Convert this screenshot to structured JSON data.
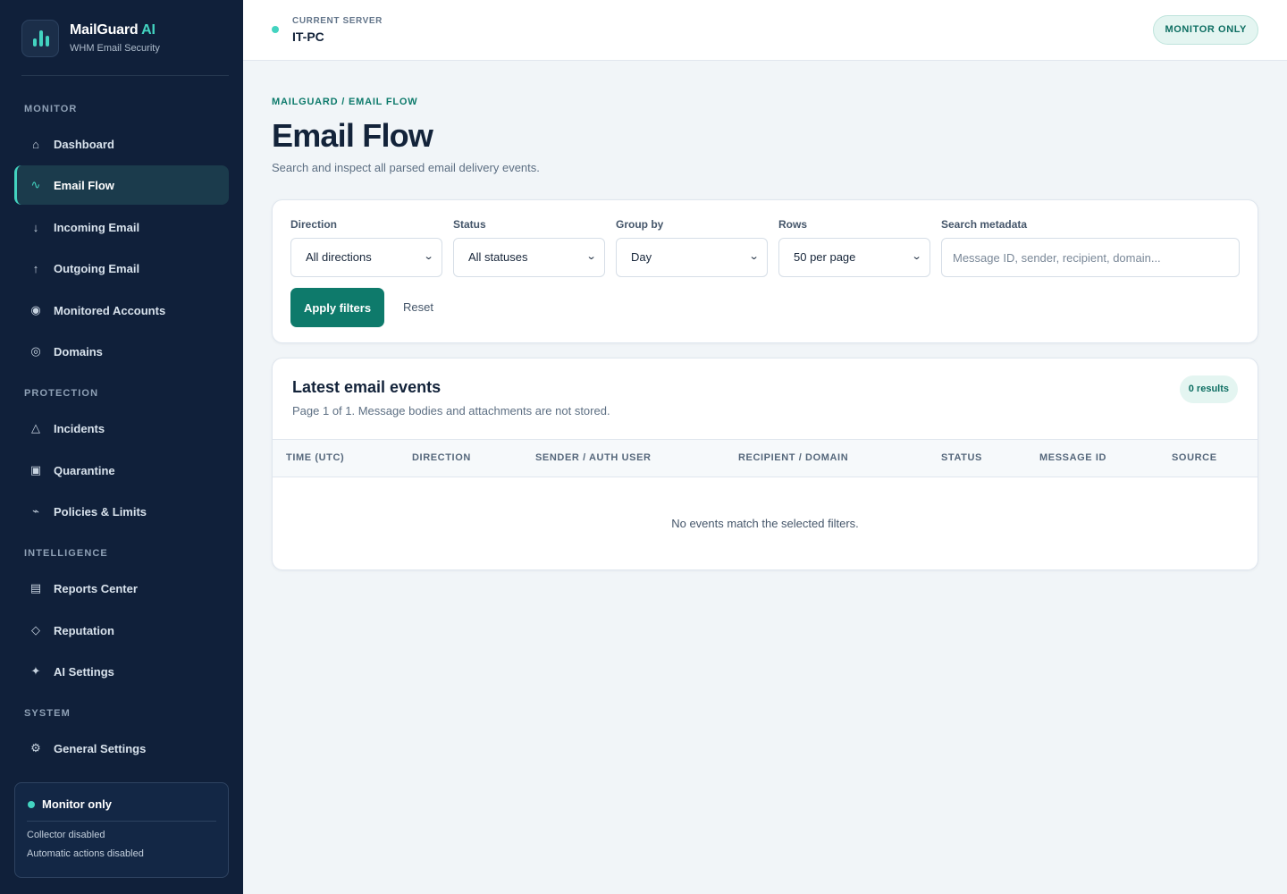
{
  "brand": {
    "name": "MailGuard",
    "name_accent": "AI",
    "subtitle": "WHM Email Security"
  },
  "sidebar": {
    "sections": {
      "monitor": "MONITOR",
      "protection": "PROTECTION",
      "intelligence": "INTELLIGENCE",
      "system": "SYSTEM"
    },
    "items": {
      "dashboard": {
        "label": "Dashboard",
        "icon": "home-icon",
        "glyph": "⌂"
      },
      "email_flow": {
        "label": "Email Flow",
        "icon": "flow-icon",
        "glyph": "∿"
      },
      "incoming": {
        "label": "Incoming Email",
        "icon": "arrow-down-icon",
        "glyph": "↓"
      },
      "outgoing": {
        "label": "Outgoing Email",
        "icon": "arrow-up-icon",
        "glyph": "↑"
      },
      "accounts": {
        "label": "Monitored Accounts",
        "icon": "accounts-icon",
        "glyph": "◉"
      },
      "domains": {
        "label": "Domains",
        "icon": "domains-icon",
        "glyph": "◎"
      },
      "incidents": {
        "label": "Incidents",
        "icon": "warning-icon",
        "glyph": "△"
      },
      "quarantine": {
        "label": "Quarantine",
        "icon": "quarantine-icon",
        "glyph": "▣"
      },
      "policies": {
        "label": "Policies & Limits",
        "icon": "policies-icon",
        "glyph": "⌁"
      },
      "reports": {
        "label": "Reports Center",
        "icon": "reports-icon",
        "glyph": "▤"
      },
      "reputation": {
        "label": "Reputation",
        "icon": "diamond-icon",
        "glyph": "◇"
      },
      "ai_settings": {
        "label": "AI Settings",
        "icon": "sparkle-icon",
        "glyph": "✦"
      },
      "general_settings": {
        "label": "General Settings",
        "icon": "gear-icon",
        "glyph": "⚙"
      }
    },
    "status_card": {
      "title": "Monitor only",
      "line1": "Collector disabled",
      "line2": "Automatic actions disabled"
    }
  },
  "topbar": {
    "server_label": "CURRENT SERVER",
    "server_name": "IT-PC",
    "mode_badge": "MONITOR ONLY"
  },
  "header": {
    "breadcrumb": "MAILGUARD / EMAIL FLOW",
    "title": "Email Flow",
    "description": "Search and inspect all parsed email delivery events."
  },
  "filters": {
    "direction": {
      "label": "Direction",
      "value": "All directions"
    },
    "status": {
      "label": "Status",
      "value": "All statuses"
    },
    "group_by": {
      "label": "Group by",
      "value": "Day"
    },
    "rows": {
      "label": "Rows",
      "value": "50 per page"
    },
    "search": {
      "label": "Search metadata",
      "placeholder": "Message ID, sender, recipient, domain...",
      "value": ""
    },
    "apply_label": "Apply filters",
    "reset_label": "Reset"
  },
  "events": {
    "title": "Latest email events",
    "subtitle": "Page 1 of 1. Message bodies and attachments are not stored.",
    "results_badge": "0 results",
    "columns": [
      "TIME (UTC)",
      "DIRECTION",
      "SENDER / AUTH USER",
      "RECIPIENT / DOMAIN",
      "STATUS",
      "MESSAGE ID",
      "SOURCE"
    ],
    "empty_message": "No events match the selected filters."
  },
  "colors": {
    "sidebar_bg": "#10203a",
    "accent": "#43d3c0",
    "primary_button": "#0e7a6b",
    "page_bg": "#f1f5f8"
  }
}
